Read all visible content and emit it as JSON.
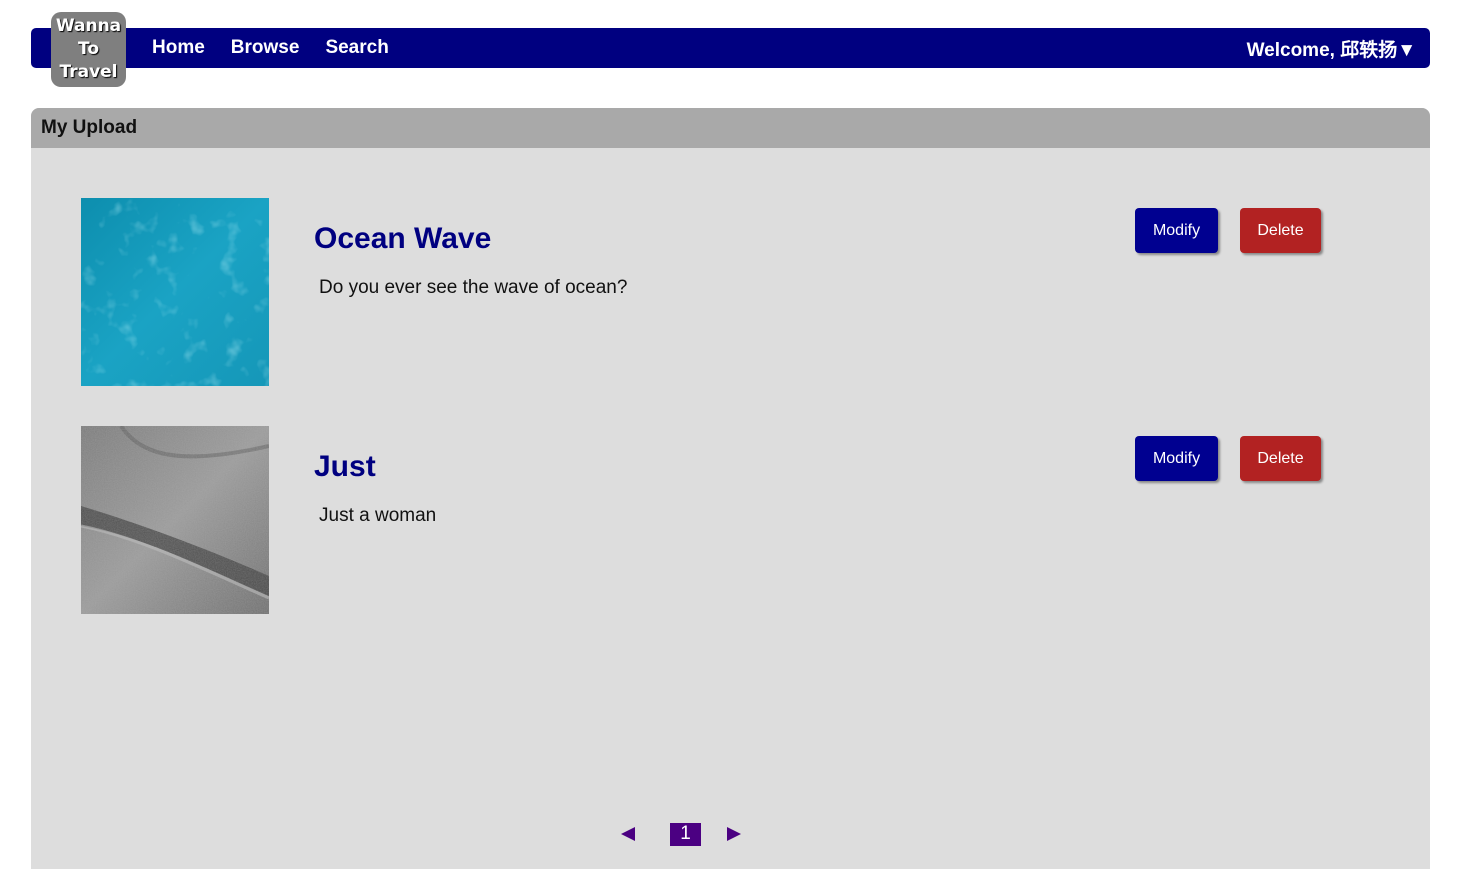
{
  "logo": {
    "lines": [
      "Wanna",
      "To",
      "Travel"
    ]
  },
  "nav": {
    "home": "Home",
    "browse": "Browse",
    "search": "Search",
    "welcome": "Welcome, 邱轶扬▼"
  },
  "panel": {
    "title": "My Upload"
  },
  "items": [
    {
      "title": "Ocean Wave",
      "description": "Do you ever see the wave of ocean?",
      "modify_label": "Modify",
      "delete_label": "Delete"
    },
    {
      "title": "Just",
      "description": "Just a woman",
      "modify_label": "Modify",
      "delete_label": "Delete"
    }
  ],
  "pagination": {
    "current_page": "1"
  },
  "colors": {
    "nav": "#000080",
    "modify": "#000090",
    "delete": "#b22222",
    "pager": "#4b0082",
    "panel": "#dddddd",
    "panel_header": "#a9a9a9"
  }
}
